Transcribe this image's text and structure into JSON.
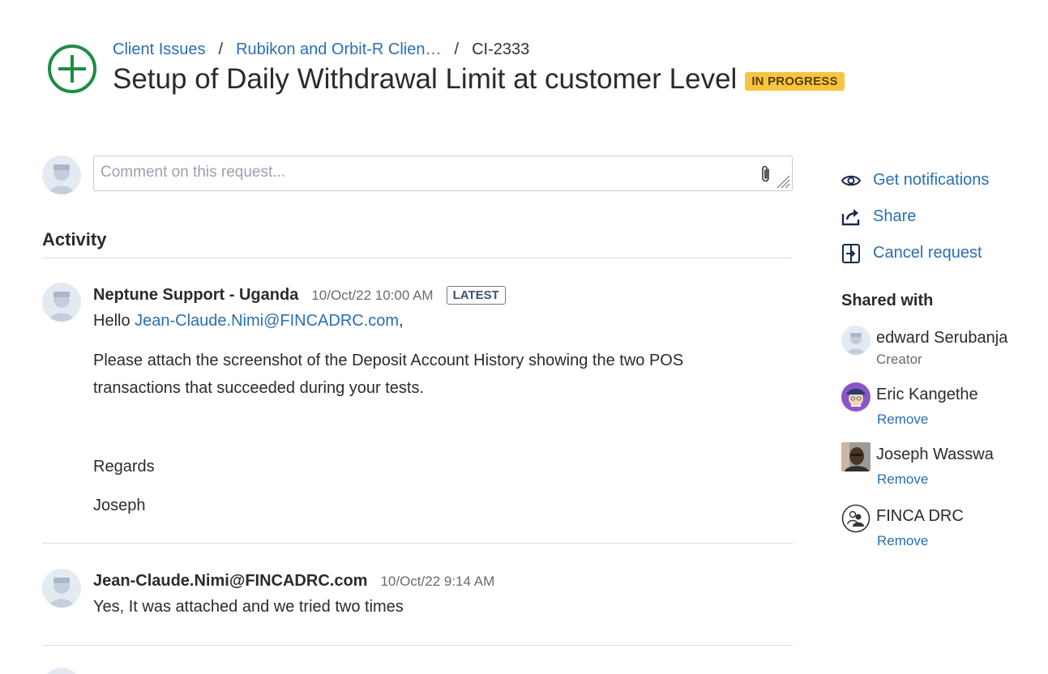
{
  "breadcrumb": {
    "project": "Client Issues",
    "service_desk": "Rubikon and Orbit-R Clien…",
    "issue_key": "CI-2333"
  },
  "header": {
    "title": "Setup of Daily Withdrawal Limit at customer Level",
    "status": "IN PROGRESS",
    "status_color": "#f5c542"
  },
  "comment": {
    "placeholder": "Comment on this request..."
  },
  "activity": {
    "heading": "Activity",
    "items": [
      {
        "author": "Neptune Support - Uganda",
        "timestamp": "10/Oct/22 10:00 AM",
        "badge": "LATEST",
        "greeting": "Hello ",
        "mention": "Jean-Claude.Nimi@FINCADRC.com",
        "greeting_end": ",",
        "paragraph_line1": "Please attach the screenshot of the Deposit Account History showing the two POS",
        "paragraph_line2": "transactions that succeeded during your tests.",
        "signoff": "Regards",
        "signature": "Joseph"
      },
      {
        "author": "Jean-Claude.Nimi@FINCADRC.com",
        "timestamp": "10/Oct/22 9:14 AM",
        "text": "Yes, It was attached and we tried two times"
      }
    ]
  },
  "sidebar": {
    "actions": [
      {
        "label": "Get notifications",
        "icon": "eye-icon"
      },
      {
        "label": "Share",
        "icon": "share-icon"
      },
      {
        "label": "Cancel request",
        "icon": "cancel-request-icon"
      }
    ],
    "shared_heading": "Shared with",
    "shared": [
      {
        "name": "edward Serubanja",
        "role": "Creator"
      },
      {
        "name": "Eric Kangethe",
        "action": "Remove"
      },
      {
        "name": "Joseph Wasswa",
        "action": "Remove"
      },
      {
        "name": "FINCA DRC",
        "action": "Remove"
      }
    ]
  },
  "colors": {
    "link": "#2a6eb3",
    "project_icon": "#1e8c45"
  }
}
